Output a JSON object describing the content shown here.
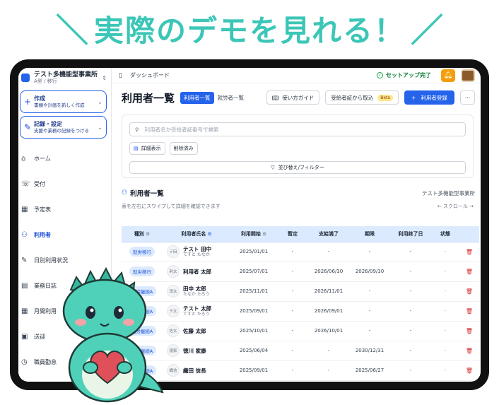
{
  "headline": {
    "slash_left": "＼",
    "text": "実際のデモを見れる！",
    "slash_right": "／"
  },
  "sidebar": {
    "office_name": "テスト多機能型事業所",
    "office_type": "A型 / 移行",
    "cards": [
      {
        "title": "作成",
        "subtitle": "書類や計画を新しく作成",
        "icon": "plus-icon"
      },
      {
        "title": "記録・設定",
        "subtitle": "支援や業務の記録をつける",
        "icon": "pencil-icon"
      }
    ],
    "nav": [
      {
        "label": "ホーム",
        "icon": "home-icon",
        "glyph": "⌂"
      },
      {
        "label": "受付",
        "icon": "phone-icon",
        "glyph": "☏"
      },
      {
        "label": "予定表",
        "icon": "calendar-icon",
        "glyph": "▦"
      },
      {
        "label": "利用者",
        "icon": "users-icon",
        "glyph": "⚇"
      },
      {
        "label": "日別利用状況",
        "icon": "pen-icon",
        "glyph": "✎"
      },
      {
        "label": "業務日誌",
        "icon": "document-icon",
        "glyph": "▤"
      },
      {
        "label": "月間利用",
        "icon": "calendar-month-icon",
        "glyph": "▦"
      },
      {
        "label": "送迎",
        "icon": "bus-icon",
        "glyph": "▣"
      },
      {
        "label": "職員勤怠",
        "icon": "clock-icon",
        "glyph": "◷"
      }
    ]
  },
  "topbar": {
    "breadcrumb": "ダッシュボード",
    "setup_status": "セットアップ完了"
  },
  "header": {
    "title": "利用者一覧",
    "segments": [
      "利用者一覧",
      "就労者一覧"
    ],
    "buttons": {
      "guide": "使い方ガイド",
      "import": "受給者証から取込",
      "beta": "Beta",
      "register": "利用者登録",
      "more": "···"
    }
  },
  "filters": {
    "search_placeholder": "利用者名か受給者証番号で検索",
    "detail_chip": "詳細表示",
    "deleted_chip": "削除済み",
    "sort_filter": "並び替え/フィルター"
  },
  "list": {
    "title": "利用者一覧",
    "office": "テスト多機能型事業所",
    "hint": "表を左右にスワイプして詳細を確認できます",
    "scroll": "← スクロール →",
    "columns": [
      "種別",
      "利用者氏名",
      "利用開始",
      "暫定",
      "支給満了",
      "期限",
      "利用終了日",
      "状態"
    ],
    "rows": [
      {
        "type": "就労移行",
        "avatar": "テ田",
        "name": "テスト 田中",
        "kana": "てすと たなか",
        "start": "2025/01/01",
        "provisional": "-",
        "grant_end": "-",
        "deadline": "-",
        "end": "-",
        "status": "-"
      },
      {
        "type": "就労移行",
        "avatar": "利太",
        "name": "利用者 太郎",
        "kana": "",
        "start": "2025/07/01",
        "provisional": "-",
        "grant_end": "2026/06/30",
        "deadline": "2026/09/30",
        "end": "-",
        "status": "-"
      },
      {
        "type": "就労継続A",
        "avatar": "田太",
        "name": "田中 太郎",
        "kana": "たなか たろう",
        "start": "2025/11/01",
        "provisional": "-",
        "grant_end": "2026/11/01",
        "deadline": "-",
        "end": "-",
        "status": "-"
      },
      {
        "type": "就労継続A",
        "avatar": "テ太",
        "name": "テスト 太郎",
        "kana": "てすと たろう",
        "start": "2025/09/01",
        "provisional": "-",
        "grant_end": "2026/09/01",
        "deadline": "-",
        "end": "-",
        "status": "-"
      },
      {
        "type": "就労継続A",
        "avatar": "佐太",
        "name": "佐藤 太郎",
        "kana": "",
        "start": "2025/10/01",
        "provisional": "-",
        "grant_end": "2026/10/01",
        "deadline": "-",
        "end": "-",
        "status": "-"
      },
      {
        "type": "就労継続A",
        "avatar": "徳家",
        "name": "徳川 家康",
        "kana": "",
        "start": "2025/06/04",
        "provisional": "-",
        "grant_end": "-",
        "deadline": "2030/12/31",
        "end": "-",
        "status": "-"
      },
      {
        "type": "就労継続A",
        "avatar": "織信",
        "name": "織田 信長",
        "kana": "",
        "start": "2025/09/01",
        "provisional": "-",
        "grant_end": "-",
        "deadline": "2025/06/27",
        "end": "-",
        "status": "-"
      }
    ]
  },
  "colors": {
    "accent": "#2563eb",
    "headline": "#3cc6b7",
    "mascot": "#4fd1b9",
    "heart": "#e0505a"
  }
}
